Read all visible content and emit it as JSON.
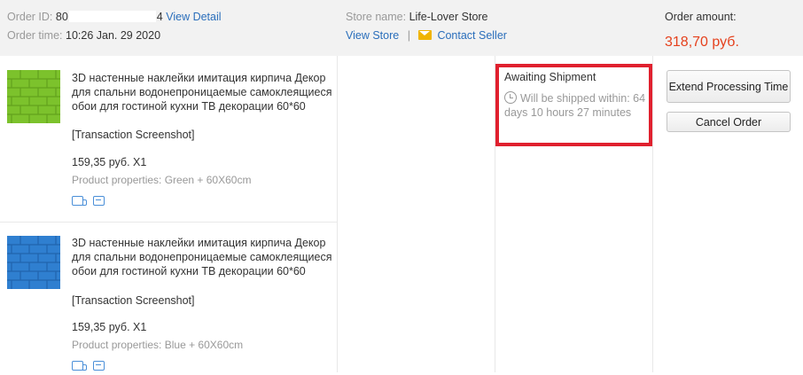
{
  "header": {
    "order_id_label": "Order ID:",
    "order_id_prefix": "80",
    "order_id_suffix": "4",
    "view_detail": "View Detail",
    "order_time_label": "Order time:",
    "order_time_value": "10:26 Jan. 29 2020",
    "store_name_label": "Store name:",
    "store_name_value": "Life-Lover Store",
    "view_store": "View Store",
    "separator": "|",
    "contact_seller": "Contact Seller",
    "order_amount_label": "Order amount:",
    "order_amount_value": "318,70 руб."
  },
  "products": [
    {
      "title": "3D настенные наклейки имитация кирпича Декор для спальни водонепроницаемые самоклеящиеся обои для гостиной кухни ТВ декорации 60*60",
      "transaction": "[Transaction Screenshot]",
      "price": "159,35 руб. X1",
      "properties": "Product properties: Green + 60X60cm",
      "color": "#7cc22c"
    },
    {
      "title": "3D настенные наклейки имитация кирпича Декор для спальни водонепроницаемые самоклеящиеся обои для гостиной кухни ТВ декорации 60*60",
      "transaction": "[Transaction Screenshot]",
      "price": "159,35 руб. X1",
      "properties": "Product properties: Blue + 60X60cm",
      "color": "#2f7fd0"
    }
  ],
  "status": {
    "title": "Awaiting Shipment",
    "detail": "Will be shipped within: 64 days 10 hours 27 minutes",
    "highlight_color": "#e0202e"
  },
  "actions": {
    "extend_processing": "Extend Processing Time",
    "cancel_order": "Cancel Order"
  },
  "colors": {
    "link": "#2a6ebb",
    "price": "#e5411d"
  }
}
